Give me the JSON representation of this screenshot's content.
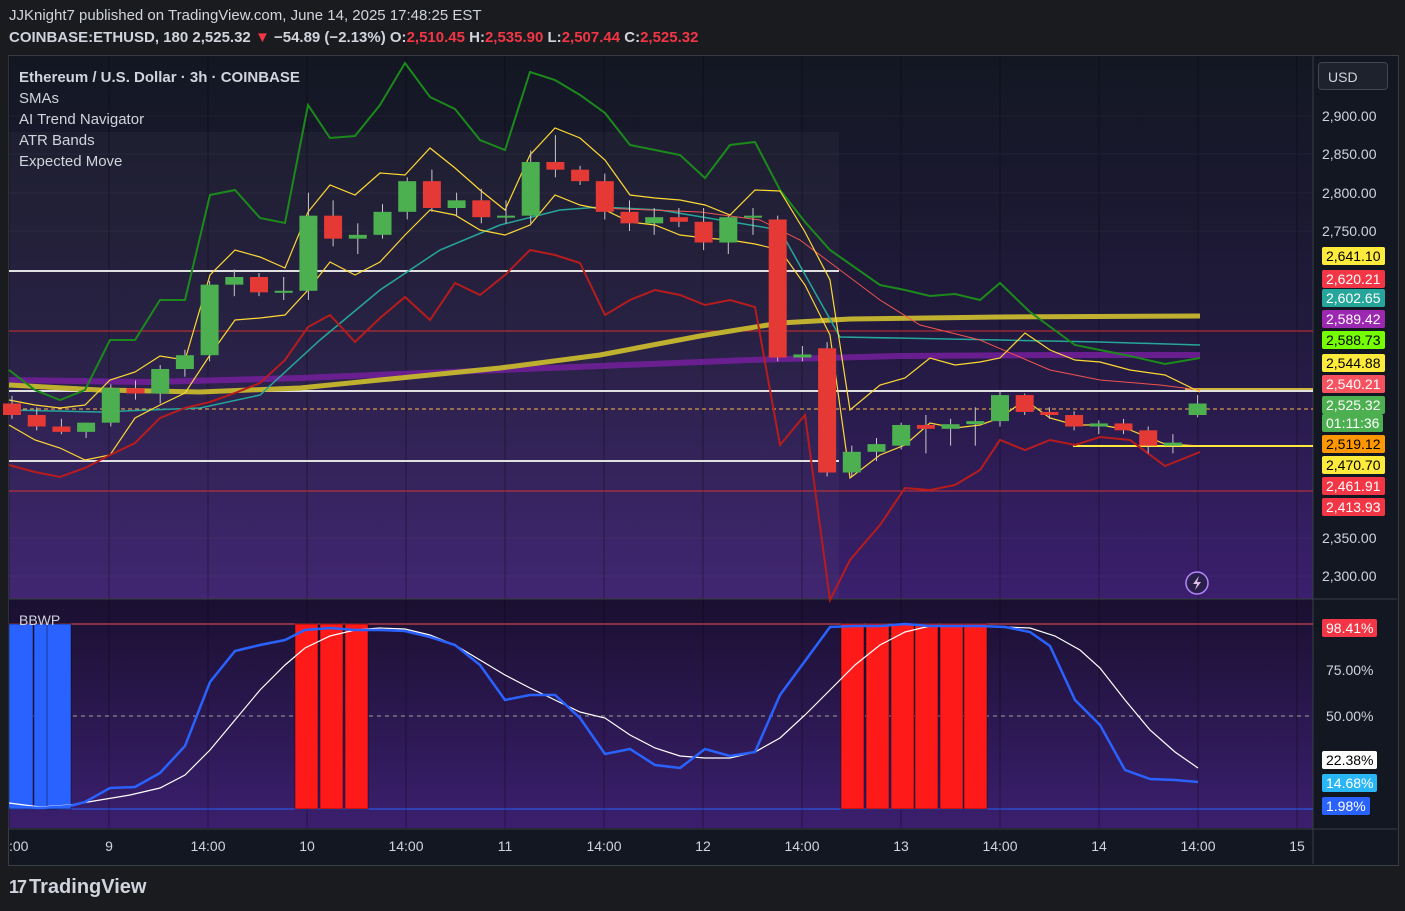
{
  "header": {
    "published": "JJKnight7 published on TradingView.com, June 14, 2025 17:48:25 EST",
    "symbol": "COINBASE:ETHUSD, 180",
    "last": "2,525.32",
    "arrow": "▼",
    "change": "−54.89 (−2.13%)",
    "o_label": "O:",
    "o_value": "2,510.45",
    "h_label": "H:",
    "h_value": "2,535.90",
    "l_label": "L:",
    "l_value": "2,507.44",
    "c_label": "C:",
    "c_value": "2,525.32"
  },
  "legend": {
    "title": "Ethereum / U.S. Dollar · 3h · COINBASE",
    "items": [
      "SMAs",
      "AI Trend Navigator",
      "ATR Bands",
      "Expected Move"
    ]
  },
  "currency_button": "USD",
  "price_axis": [
    "2,900.00",
    "2,850.00",
    "2,800.00",
    "2,750.00",
    "2,350.00",
    "2,300.00"
  ],
  "price_tags": [
    {
      "text": "2,641.10",
      "bg": "#ffeb3b",
      "fg": "#000000"
    },
    {
      "text": "2,620.21",
      "bg": "#f23645",
      "fg": "#ffffff"
    },
    {
      "text": "2,602.65",
      "bg": "#26a69a",
      "fg": "#ffffff"
    },
    {
      "text": "2,589.42",
      "bg": "#9c27b0",
      "fg": "#ffffff"
    },
    {
      "text": "2,588.73",
      "bg": "#76ff03",
      "fg": "#000000"
    },
    {
      "text": "2,544.88",
      "bg": "#ffeb3b",
      "fg": "#000000"
    },
    {
      "text": "2,540.21",
      "bg": "#f7525f",
      "fg": "#ffffff"
    },
    {
      "text": "2,525.32",
      "bg": "#4caf50",
      "fg": "#ffffff"
    },
    {
      "text": "01:11:36",
      "bg": "#4caf50",
      "fg": "#ffffff"
    },
    {
      "text": "2,519.12",
      "bg": "#ff9800",
      "fg": "#000000"
    },
    {
      "text": "2,470.70",
      "bg": "#ffeb3b",
      "fg": "#000000"
    },
    {
      "text": "2,461.91",
      "bg": "#f23645",
      "fg": "#ffffff"
    },
    {
      "text": "2,413.93",
      "bg": "#f23645",
      "fg": "#ffffff"
    }
  ],
  "indicator": {
    "name": "BBWP",
    "axis": [
      "75.00%",
      "50.00%"
    ],
    "tags": [
      {
        "text": "98.41%",
        "bg": "#f23645",
        "fg": "#ffffff"
      },
      {
        "text": "22.38%",
        "bg": "#ffffff",
        "fg": "#000000"
      },
      {
        "text": "14.68%",
        "bg": "#29b6f6",
        "fg": "#ffffff"
      },
      {
        "text": "1.98%",
        "bg": "#2962ff",
        "fg": "#ffffff"
      }
    ]
  },
  "time_axis": [
    ":00",
    "9",
    "14:00",
    "10",
    "14:00",
    "11",
    "14:00",
    "12",
    "14:00",
    "13",
    "14:00",
    "14",
    "14:00",
    "15"
  ],
  "brand": "TradingView",
  "colors": {
    "up": "#4caf50",
    "down": "#e53935",
    "bg_top": "#131722",
    "bg_bottom": "#3b1f6e"
  },
  "chart_data": {
    "type": "candlestick",
    "interval": "3h",
    "candles": [
      {
        "o": 2525,
        "h": 2535,
        "l": 2505,
        "c": 2510
      },
      {
        "o": 2510,
        "h": 2520,
        "l": 2490,
        "c": 2495
      },
      {
        "o": 2495,
        "h": 2505,
        "l": 2485,
        "c": 2488
      },
      {
        "o": 2488,
        "h": 2500,
        "l": 2480,
        "c": 2500
      },
      {
        "o": 2500,
        "h": 2550,
        "l": 2495,
        "c": 2545
      },
      {
        "o": 2545,
        "h": 2555,
        "l": 2530,
        "c": 2538
      },
      {
        "o": 2538,
        "h": 2575,
        "l": 2525,
        "c": 2570
      },
      {
        "o": 2570,
        "h": 2595,
        "l": 2560,
        "c": 2588
      },
      {
        "o": 2588,
        "h": 2685,
        "l": 2580,
        "c": 2680
      },
      {
        "o": 2680,
        "h": 2700,
        "l": 2665,
        "c": 2690
      },
      {
        "o": 2690,
        "h": 2695,
        "l": 2665,
        "c": 2670
      },
      {
        "o": 2670,
        "h": 2690,
        "l": 2660,
        "c": 2672
      },
      {
        "o": 2672,
        "h": 2800,
        "l": 2660,
        "c": 2770
      },
      {
        "o": 2770,
        "h": 2790,
        "l": 2730,
        "c": 2740
      },
      {
        "o": 2740,
        "h": 2760,
        "l": 2720,
        "c": 2745
      },
      {
        "o": 2745,
        "h": 2785,
        "l": 2740,
        "c": 2775
      },
      {
        "o": 2775,
        "h": 2820,
        "l": 2765,
        "c": 2815
      },
      {
        "o": 2815,
        "h": 2830,
        "l": 2775,
        "c": 2780
      },
      {
        "o": 2780,
        "h": 2800,
        "l": 2770,
        "c": 2790
      },
      {
        "o": 2790,
        "h": 2805,
        "l": 2760,
        "c": 2768
      },
      {
        "o": 2768,
        "h": 2790,
        "l": 2760,
        "c": 2770
      },
      {
        "o": 2770,
        "h": 2855,
        "l": 2760,
        "c": 2840
      },
      {
        "o": 2840,
        "h": 2875,
        "l": 2820,
        "c": 2830
      },
      {
        "o": 2830,
        "h": 2835,
        "l": 2810,
        "c": 2815
      },
      {
        "o": 2815,
        "h": 2825,
        "l": 2765,
        "c": 2775
      },
      {
        "o": 2775,
        "h": 2790,
        "l": 2750,
        "c": 2760
      },
      {
        "o": 2760,
        "h": 2780,
        "l": 2745,
        "c": 2768
      },
      {
        "o": 2768,
        "h": 2780,
        "l": 2755,
        "c": 2762
      },
      {
        "o": 2762,
        "h": 2780,
        "l": 2725,
        "c": 2735
      },
      {
        "o": 2735,
        "h": 2770,
        "l": 2720,
        "c": 2768
      },
      {
        "o": 2768,
        "h": 2780,
        "l": 2745,
        "c": 2770
      },
      {
        "o": 2765,
        "h": 2770,
        "l": 2580,
        "c": 2585
      },
      {
        "o": 2585,
        "h": 2600,
        "l": 2580,
        "c": 2589
      },
      {
        "o": 2597,
        "h": 2605,
        "l": 2430,
        "c": 2435
      },
      {
        "o": 2435,
        "h": 2470,
        "l": 2430,
        "c": 2462
      },
      {
        "o": 2462,
        "h": 2480,
        "l": 2450,
        "c": 2472
      },
      {
        "o": 2470,
        "h": 2500,
        "l": 2465,
        "c": 2497
      },
      {
        "o": 2497,
        "h": 2510,
        "l": 2460,
        "c": 2492
      },
      {
        "o": 2492,
        "h": 2505,
        "l": 2470,
        "c": 2498
      },
      {
        "o": 2498,
        "h": 2520,
        "l": 2470,
        "c": 2502
      },
      {
        "o": 2502,
        "h": 2540,
        "l": 2495,
        "c": 2536
      },
      {
        "o": 2536,
        "h": 2538,
        "l": 2510,
        "c": 2514
      },
      {
        "o": 2514,
        "h": 2520,
        "l": 2505,
        "c": 2510
      },
      {
        "o": 2510,
        "h": 2515,
        "l": 2490,
        "c": 2495
      },
      {
        "o": 2495,
        "h": 2503,
        "l": 2485,
        "c": 2499
      },
      {
        "o": 2499,
        "h": 2505,
        "l": 2485,
        "c": 2490
      },
      {
        "o": 2490,
        "h": 2495,
        "l": 2460,
        "c": 2470
      },
      {
        "o": 2470,
        "h": 2485,
        "l": 2460,
        "c": 2474
      },
      {
        "o": 2510,
        "h": 2536,
        "l": 2507,
        "c": 2525
      }
    ]
  }
}
